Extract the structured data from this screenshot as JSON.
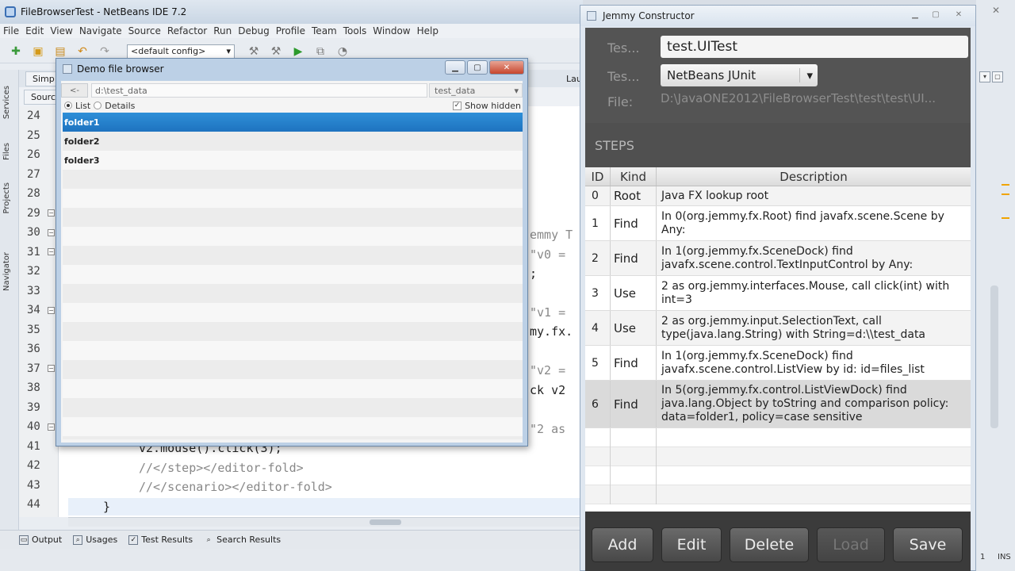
{
  "ide": {
    "title": "FileBrowserTest - NetBeans IDE 7.2",
    "menu": [
      "File",
      "Edit",
      "View",
      "Navigate",
      "Source",
      "Refactor",
      "Run",
      "Debug",
      "Profile",
      "Team",
      "Tools",
      "Window",
      "Help"
    ],
    "config_select": "<default config>",
    "side_tabs": [
      "Services",
      "Files",
      "Projects",
      "Navigator"
    ],
    "editor_tab": "Simp",
    "editor_tab_right": "Lau",
    "source_label": "Source",
    "line_numbers": [
      "24",
      "25",
      "26",
      "27",
      "28",
      "29",
      "30",
      "31",
      "32",
      "33",
      "34",
      "35",
      "36",
      "37",
      "38",
      "39",
      "40",
      "41",
      "42",
      "43",
      "44"
    ],
    "code_fragments": {
      "c30": "emmy T",
      "c31": "\"v0 =",
      "c32": ";",
      "c34": "\"v1 =",
      "c35": "my.fx.",
      "c37": "\"v2 =",
      "c38": "ck v2",
      "c40": "\"2 as",
      "c41": "v2.mouse().click(3);",
      "c42": "//</step></editor-fold>",
      "c43": "//</scenario></editor-fold>",
      "c44": "}"
    },
    "status_items": [
      "Output",
      "Usages",
      "Test Results",
      "Search Results"
    ],
    "ins": "INS",
    "col": "1"
  },
  "file_browser": {
    "title": "Demo file browser",
    "back_label": "<-",
    "path_value": "d:\\test_data",
    "dir_select": "test_data",
    "view_list": "List",
    "view_details": "Details",
    "show_hidden": "Show hidden",
    "items": [
      {
        "name": "folder1",
        "selected": true
      },
      {
        "name": "folder2",
        "selected": false
      },
      {
        "name": "folder3",
        "selected": false
      }
    ]
  },
  "jemmy": {
    "title": "Jemmy Constructor",
    "test_label": "Tes...",
    "test_value": "test.UITest",
    "type_label": "Tes...",
    "type_value": "NetBeans JUnit",
    "file_label": "File:",
    "file_value": "D:\\JavaONE2012\\FileBrowserTest\\test\\test\\UI...",
    "steps_header": "STEPS",
    "columns": {
      "id": "ID",
      "kind": "Kind",
      "description": "Description"
    },
    "steps": [
      {
        "id": "0",
        "kind": "Root",
        "description": "Java FX lookup root"
      },
      {
        "id": "1",
        "kind": "Find",
        "description": "In 0(org.jemmy.fx.Root) find javafx.scene.Scene by Any:"
      },
      {
        "id": "2",
        "kind": "Find",
        "description": "In 1(org.jemmy.fx.SceneDock) find javafx.scene.control.TextInputControl by Any:"
      },
      {
        "id": "3",
        "kind": "Use",
        "description": "2 as org.jemmy.interfaces.Mouse, call click(int) with int=3"
      },
      {
        "id": "4",
        "kind": "Use",
        "description": "2 as org.jemmy.input.SelectionText, call type(java.lang.String) with String=d:\\\\test_data"
      },
      {
        "id": "5",
        "kind": "Find",
        "description": "In 1(org.jemmy.fx.SceneDock) find javafx.scene.control.ListView by id: id=files_list"
      },
      {
        "id": "6",
        "kind": "Find",
        "description": "In 5(org.jemmy.fx.control.ListViewDock) find java.lang.Object by toString and comparison policy: data=folder1, policy=case sensitive"
      }
    ],
    "buttons": {
      "add": "Add",
      "edit": "Edit",
      "delete": "Delete",
      "load": "Load",
      "save": "Save"
    }
  }
}
